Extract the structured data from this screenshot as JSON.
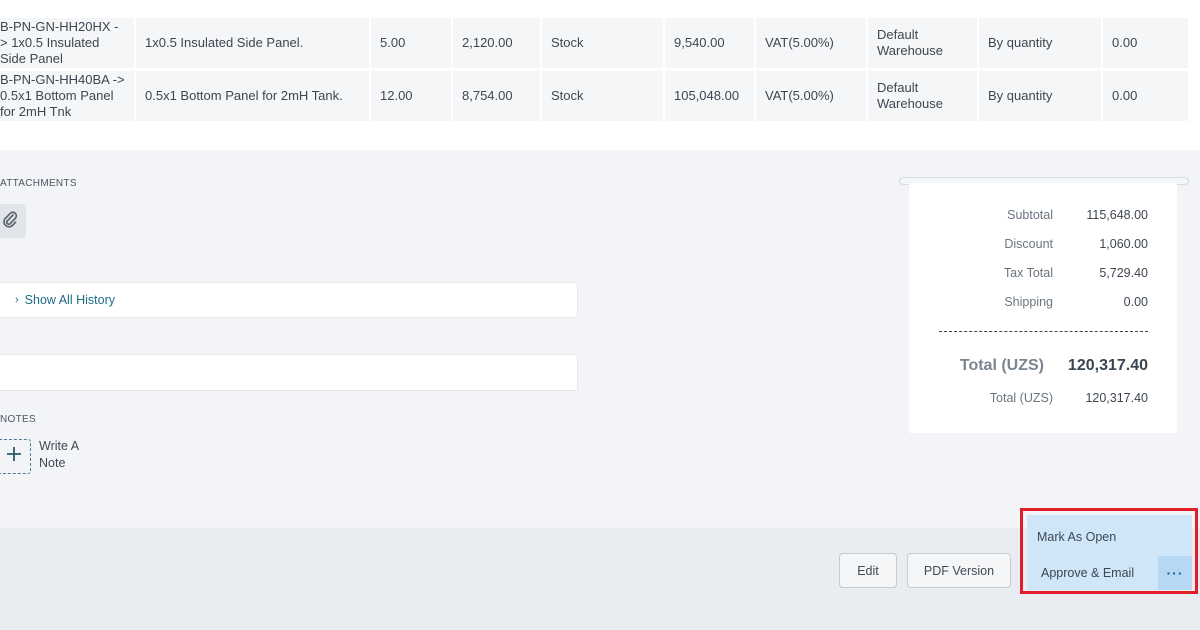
{
  "items": [
    {
      "item": "B-PN-GN-HH20HX -> 1x0.5 Insulated Side Panel",
      "description": "1x0.5 Insulated Side Panel.",
      "quantity": "5.00",
      "rate": "2,120.00",
      "type": "Stock",
      "amount": "9,540.00",
      "tax": "VAT(5.00%)",
      "warehouse": "Default Warehouse",
      "discount_type": "By quantity",
      "discount": "0.00"
    },
    {
      "item": "B-PN-GN-HH40BA -> 0.5x1 Bottom Panel for 2mH Tnk",
      "description": "0.5x1 Bottom Panel for 2mH Tank.",
      "quantity": "12.00",
      "rate": "8,754.00",
      "type": "Stock",
      "amount": "105,048.00",
      "tax": "VAT(5.00%)",
      "warehouse": "Default Warehouse",
      "discount_type": "By quantity",
      "discount": "0.00"
    }
  ],
  "attachments": {
    "label": "ATTACHMENTS",
    "icon": "paperclip-icon"
  },
  "history": {
    "label": "Show All History"
  },
  "notes": {
    "label": "NOTES",
    "add_label": "Write A Note"
  },
  "summary": {
    "subtotal_label": "Subtotal",
    "subtotal": "115,648.00",
    "discount_label": "Discount",
    "discount": "1,060.00",
    "tax_label": "Tax Total",
    "tax": "5,729.40",
    "shipping_label": "Shipping",
    "shipping": "0.00",
    "total_label": "Total (UZS)",
    "total": "120,317.40",
    "total2_label": "Total (UZS)",
    "total2": "120,317.40"
  },
  "actions": {
    "edit": "Edit",
    "pdf": "PDF Version",
    "mark_open": "Mark As Open",
    "approve_email": "Approve & Email",
    "more": "···"
  },
  "colors": {
    "link": "#1f6c86",
    "highlight": "#e11d2a",
    "action_bg": "#cfe6f8"
  }
}
